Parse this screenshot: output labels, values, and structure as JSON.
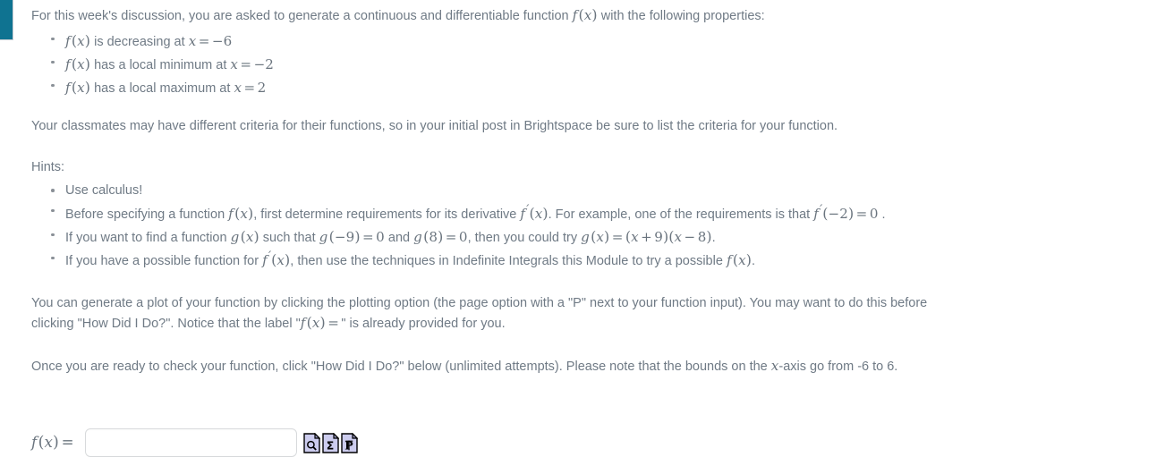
{
  "accent": {
    "color": "#0f7391",
    "name": "left-accent-bar"
  },
  "colors": {
    "body_text": "#6f7a85",
    "math_text": "#6a747e",
    "icon_fill": "#ccccee",
    "icon_stroke": "#000000",
    "input_border": "#d8dadc"
  },
  "intro": {
    "lead_text": "For this week's discussion, you are asked to generate a continuous and differentiable function ",
    "math_fx": "f (x)",
    "tail_text": " with the following properties:"
  },
  "properties": [
    {
      "math_lead": "f (x)",
      "text": " is decreasing at ",
      "math_tail": "x = −6"
    },
    {
      "math_lead": "f (x)",
      "text": " has a local minimum at ",
      "math_tail": "x = −2"
    },
    {
      "math_lead": "f (x)",
      "text": " has a local maximum at ",
      "math_tail": "x = 2"
    }
  ],
  "classmates_note": "Your classmates may have different criteria for their functions, so in your initial post in Brightspace be sure to list the criteria for your function.",
  "hints": {
    "heading": "Hints:",
    "items": [
      {
        "id": "hint-use-calculus",
        "p1": "Use calculus!"
      },
      {
        "id": "hint-derivative-requirements",
        "p1": "Before specifying a function ",
        "m1": "f (x)",
        "p2": ", first determine requirements for its derivative ",
        "m2": "f′ (x)",
        "p3": ". For example, one of the requirements is that ",
        "m3": "f′ (−2) = 0",
        "p4": " ."
      },
      {
        "id": "hint-roots-example",
        "p1": "If you want to find a function ",
        "m1": "g (x)",
        "p2": " such that ",
        "m2": "g (−9) = 0",
        "p3": " and ",
        "m3": "g (8) = 0",
        "p4": ", then you could try  ",
        "m4": "g (x) = (x + 9) (x − 8)",
        "p5": "."
      },
      {
        "id": "hint-antiderivative",
        "p1": "If you have a possible function for ",
        "m1": "f′ (x)",
        "p2": ", then use the techniques in Indefinite Integrals this Module to try a possible ",
        "m2": "f (x)",
        "p3": "."
      }
    ]
  },
  "plot_paragraph": {
    "line1": "You can generate a plot of your function by clicking the plotting option (the page option with a \"P\" next to your function input). You may want to do this before",
    "line2_pre": "clicking \"How Did I Do?\". Notice that the label \"",
    "line2_math": "f (x) =",
    "line2_post": "\" is already provided for you."
  },
  "check_paragraph": {
    "pre": "Once you are ready to check your function, click \"How Did I Do?\" below (unlimited attempts). Please note that the bounds on the ",
    "math": "x",
    "post": "-axis go from -6 to 6."
  },
  "answer": {
    "label": "f (x) =",
    "input_value": "",
    "input_placeholder": "",
    "icons": [
      {
        "name": "document-preview-icon",
        "glyph": "magnifier",
        "title": "Preview"
      },
      {
        "name": "document-sigma-icon",
        "glyph": "sigma",
        "title": "Symbolic"
      },
      {
        "name": "document-plot-icon",
        "glyph": "P",
        "title": "Plot"
      }
    ]
  }
}
